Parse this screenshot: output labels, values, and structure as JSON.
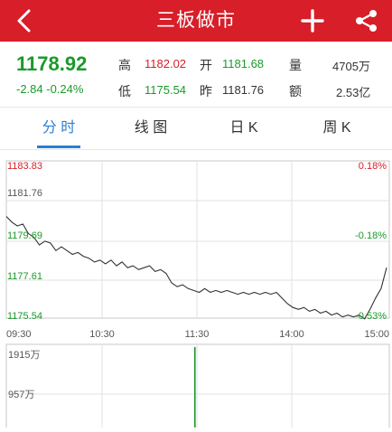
{
  "header": {
    "title": "三板做市"
  },
  "quote": {
    "price": "1178.92",
    "change": "-2.84 -0.24%",
    "high_label": "高",
    "high_value": "1182.02",
    "open_label": "开",
    "open_value": "1181.68",
    "volume_label": "量",
    "volume_value": "4705万",
    "low_label": "低",
    "low_value": "1175.54",
    "prev_close_label": "昨",
    "prev_close_value": "1181.76",
    "amount_label": "额",
    "amount_value": "2.53亿"
  },
  "tabs": [
    {
      "label": "分 时",
      "active": true
    },
    {
      "label": "线 图",
      "active": false
    },
    {
      "label": "日 K",
      "active": false
    },
    {
      "label": "周 K",
      "active": false
    }
  ],
  "colors": {
    "header": "#d81e28",
    "up": "#d81e28",
    "down": "#1a9a2a",
    "accent": "#2a7fd4"
  },
  "chart_data": {
    "type": "line",
    "price_axis": {
      "ticks": [
        "1183.83",
        "1181.76",
        "1179.69",
        "1177.61",
        "1175.54"
      ],
      "ylim": [
        1175.54,
        1183.83
      ]
    },
    "percent_axis": {
      "ticks": [
        "0.18%",
        "-0.18%",
        "-0.53%"
      ]
    },
    "time_ticks": [
      "09:30",
      "10:30",
      "11:30",
      "14:00",
      "15:00"
    ],
    "series": [
      {
        "values": [
          1180.9,
          1180.6,
          1180.4,
          1180.5,
          1180.0,
          1179.8,
          1179.4,
          1179.6,
          1179.5,
          1179.1,
          1179.3,
          1179.1,
          1178.9,
          1179.0,
          1178.8,
          1178.7,
          1178.5,
          1178.6,
          1178.4,
          1178.6,
          1178.3,
          1178.5,
          1178.2,
          1178.3,
          1178.1,
          1178.2,
          1178.3,
          1178.0,
          1178.1,
          1177.9,
          1177.4,
          1177.2,
          1177.3,
          1177.1,
          1177.0,
          1176.9,
          1177.1,
          1176.9,
          1177.0,
          1176.9,
          1177.0,
          1176.9,
          1176.8,
          1176.9,
          1176.8,
          1176.9,
          1176.8,
          1176.9,
          1176.8,
          1176.9,
          1176.6,
          1176.3,
          1176.1,
          1176.0,
          1176.1,
          1175.9,
          1176.0,
          1175.8,
          1175.9,
          1175.7,
          1175.8,
          1175.6,
          1175.7,
          1175.6,
          1175.7,
          1175.5,
          1176.0,
          1176.6,
          1177.1,
          1178.2
        ]
      }
    ],
    "volume_axis": {
      "ticks": [
        "1915万",
        "957万"
      ],
      "ylim": [
        0,
        1915
      ]
    }
  }
}
